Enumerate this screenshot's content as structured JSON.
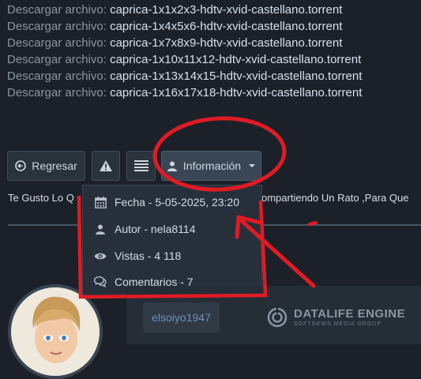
{
  "downloads": {
    "prefix": "Descargar archivo:",
    "files": [
      "caprica-1x1x2x3-hdtv-xvid-castellano.torrent",
      "caprica-1x4x5x6-hdtv-xvid-castellano.torrent",
      "caprica-1x7x8x9-hdtv-xvid-castellano.torrent",
      "caprica-1x10x11x12-hdtv-xvid-castellano.torrent",
      "caprica-1x13x14x15-hdtv-xvid-castellano.torrent",
      "caprica-1x16x17x18-hdtv-xvid-castellano.torrent"
    ]
  },
  "toolbar": {
    "back_label": "Regresar",
    "info_label": "Información"
  },
  "description": {
    "left": "Te Gusto Lo Q",
    "right": "ompartiendo Un Rato ,Para Que"
  },
  "info_menu": {
    "date": "Fecha - 5-05-2025, 23:20",
    "author": "Autor - nela8114",
    "views": "Vistas - 4 118",
    "comments": "Comentarios - 7"
  },
  "user": {
    "name": "elsoiyo1947"
  },
  "logo": {
    "title": "DATALIFE ENGINE",
    "subtitle": "SOFTNEWS MEDIA GROUP"
  },
  "colors": {
    "background": "#1c2129",
    "annotation_red": "#e01b24"
  }
}
